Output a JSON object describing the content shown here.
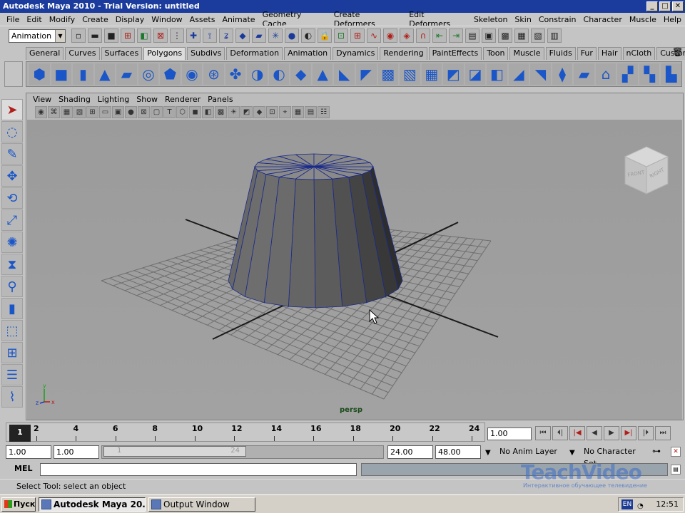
{
  "window": {
    "title": "Autodesk Maya 2010 - Trial Version: untitled",
    "min": "_",
    "max": "□",
    "close": "✕"
  },
  "menubar": [
    "File",
    "Edit",
    "Modify",
    "Create",
    "Display",
    "Window",
    "Assets",
    "Animate",
    "Geometry Cache",
    "Create Deformers",
    "Edit Deformers",
    "Skeleton",
    "Skin",
    "Constrain",
    "Character",
    "Muscle",
    "Help"
  ],
  "statusline": {
    "mode": "Animation"
  },
  "shelf": {
    "tabs": [
      "General",
      "Curves",
      "Surfaces",
      "Polygons",
      "Subdivs",
      "Deformation",
      "Animation",
      "Dynamics",
      "Rendering",
      "PaintEffects",
      "Toon",
      "Muscle",
      "Fluids",
      "Fur",
      "Hair",
      "nCloth",
      "Custom"
    ],
    "active_tab": "Polygons"
  },
  "panel": {
    "menu": [
      "View",
      "Shading",
      "Lighting",
      "Show",
      "Renderer",
      "Panels"
    ],
    "camera": "persp",
    "viewcube": {
      "front": "FRONT",
      "right": "RIGHT"
    },
    "axis": {
      "x": "x",
      "y": "y",
      "z": "z"
    }
  },
  "timeline": {
    "current_frame": "1",
    "ticks": [
      "2",
      "4",
      "6",
      "8",
      "10",
      "12",
      "14",
      "16",
      "18",
      "20",
      "22",
      "24"
    ],
    "current_time": "1.00"
  },
  "range": {
    "start": "1.00",
    "playback_start": "1.00",
    "thumb_start": "1",
    "thumb_end": "24",
    "playback_end": "24.00",
    "end": "48.00",
    "anim_layer": "No Anim Layer",
    "character_set": "No Character Set"
  },
  "command": {
    "label": "MEL",
    "value": ""
  },
  "help_line": "Select Tool: select an object",
  "watermark": {
    "title": "TeachVideo",
    "subtitle": "Интерактивное обучающее телевидение"
  },
  "taskbar": {
    "start": "Пуск",
    "tasks": [
      "Autodesk Maya 20...",
      "Output Window"
    ],
    "lang": "EN",
    "clock": "12:51"
  }
}
